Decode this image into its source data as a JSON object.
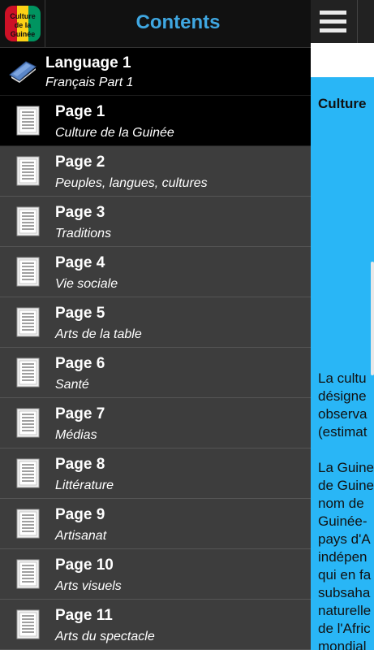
{
  "app": {
    "icon_label": "Culture de la Guinée",
    "icon_colors": [
      "#ce1126",
      "#fcd116",
      "#009460"
    ]
  },
  "header": {
    "title": "Contents"
  },
  "language": {
    "label": "Language 1",
    "sub": "Français Part 1"
  },
  "pages": [
    {
      "label": "Page 1",
      "sub": "Culture de la Guinée",
      "selected": true
    },
    {
      "label": "Page 2",
      "sub": "Peuples, langues, cultures"
    },
    {
      "label": "Page 3",
      "sub": "Traditions"
    },
    {
      "label": "Page 4",
      "sub": "Vie sociale"
    },
    {
      "label": "Page 5",
      "sub": "Arts de la table"
    },
    {
      "label": "Page 6",
      "sub": "Santé"
    },
    {
      "label": "Page 7",
      "sub": "Médias"
    },
    {
      "label": "Page 8",
      "sub": "Littérature"
    },
    {
      "label": "Page 9",
      "sub": "Artisanat"
    },
    {
      "label": "Page 10",
      "sub": "Arts visuels"
    },
    {
      "label": "Page 11",
      "sub": "Arts du spectacle"
    }
  ],
  "content": {
    "heading": "Culture",
    "para1": [
      "La cultu",
      "désigne",
      "observa",
      "(estimat"
    ],
    "para2": [
      "La Guine",
      "de Guine",
      "nom de",
      "Guinée-",
      "pays d'A",
      "indépen",
      "qui en fa",
      "subsaha",
      "naturelle",
      "de l'Afric",
      "mondial"
    ]
  }
}
